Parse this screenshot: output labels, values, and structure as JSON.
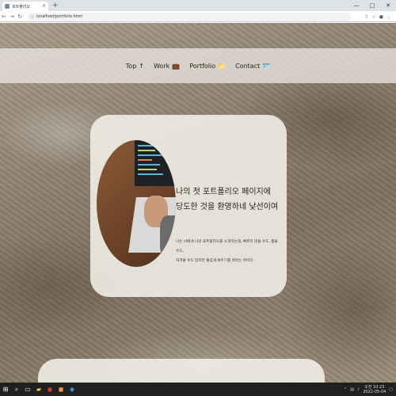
{
  "browser": {
    "tab_title": "포트폴리오",
    "tab_close": "×",
    "new_tab": "+",
    "url": "localhost/portfolio.html",
    "window_controls": [
      "—",
      "□",
      "✕"
    ]
  },
  "nav": {
    "items": [
      {
        "label": "Top",
        "icon": "↑"
      },
      {
        "label": "Work",
        "icon": "💼"
      },
      {
        "label": "Portfolio",
        "icon": "📁"
      },
      {
        "label": "Contact",
        "icon": "🪪"
      }
    ]
  },
  "hero": {
    "headline_line1": "나의 첫 포트폴리오 페이지에",
    "headline_line2": "당도한 것을 환영하네 낯선이여",
    "desc_line1": "나는 너에게 나의 포트폴리오를 소개하는데, 빠르지 않을 수도, 짧을 수도,",
    "desc_line2": "지겨울 수도 있지만 즐겁게 봐주기를 바라는 바이다."
  },
  "taskbar": {
    "time": "오전 10:23",
    "date": "2022-05-04"
  }
}
